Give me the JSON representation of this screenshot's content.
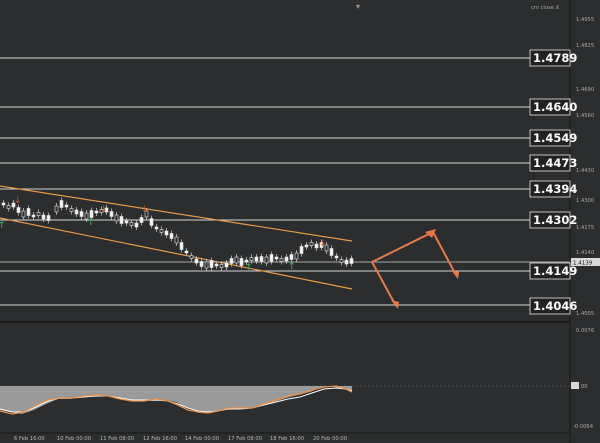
{
  "window": {
    "indicator_label": "cm close X",
    "colors": {
      "background": "#2b2d2e",
      "gridline": "#d6d6d6",
      "channel": "#e79a4a",
      "arrow": "#e8794a",
      "signal_up": "#3fbf57",
      "signal_down": "#e0552a",
      "macd_fill": "#9a9a9a",
      "macd_line": "#e8904a",
      "signal_line": "#ffffff"
    }
  },
  "chart_data": {
    "type": "candlestick",
    "price_axis_ticks": [
      "1.4955",
      "1.4825",
      "1.4690",
      "1.4560",
      "1.4430",
      "1.4300",
      "1.4175",
      "1.4140",
      "1.4005"
    ],
    "current_price_label": "1.4139",
    "levels": [
      {
        "label": "1.4789",
        "price": 1.4789
      },
      {
        "label": "1.4640",
        "price": 1.464
      },
      {
        "label": "1.4549",
        "price": 1.4549
      },
      {
        "label": "1.4473",
        "price": 1.4473
      },
      {
        "label": "1.4394",
        "price": 1.4394
      },
      {
        "label": "1.4302",
        "price": 1.4302
      },
      {
        "label": "1.4149",
        "price": 1.4149
      },
      {
        "label": "1.4046",
        "price": 1.4046
      }
    ],
    "time_axis_labels": [
      "6 Feb 16:00",
      "10 Feb 00:00",
      "11 Feb 08:00",
      "12 Feb 16:00",
      "14 Feb 00:00",
      "17 Feb 08:00",
      "18 Feb 16:00",
      "20 Feb 00:00"
    ],
    "subwindow_ticks": [
      "0.0076",
      "0.00",
      "-0.0064"
    ],
    "channel": {
      "upper": {
        "from": 1.4395,
        "to": 1.4245
      },
      "lower": {
        "from": 1.4312,
        "to": 1.408
      }
    },
    "forecast": [
      {
        "from": 1.4149,
        "to": 1.428
      },
      {
        "from": 1.428,
        "to": 1.4125
      },
      {
        "from": 1.4149,
        "to": 1.404
      }
    ]
  }
}
